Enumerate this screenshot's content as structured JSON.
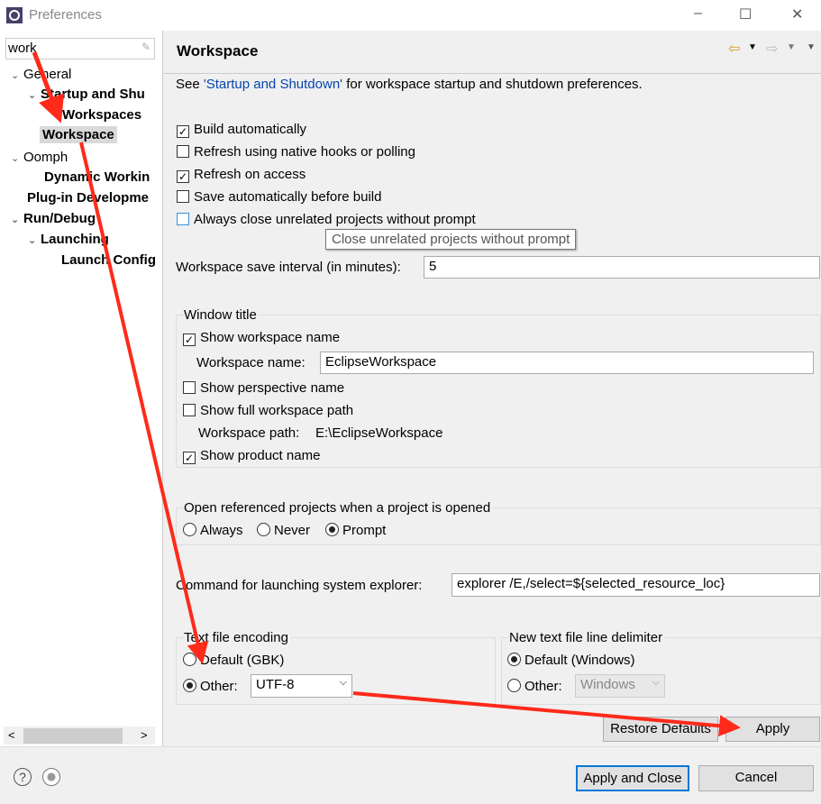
{
  "window": {
    "title": "Preferences",
    "minimize": "–",
    "maximize": "☐",
    "close": "✕"
  },
  "filter": {
    "value": "work"
  },
  "tree": [
    {
      "label": "General",
      "bold": false
    },
    {
      "label": "Startup and Shu",
      "bold": true
    },
    {
      "label": "Workspaces",
      "bold": true
    },
    {
      "label": "Workspace",
      "bold": true,
      "selected": true
    },
    {
      "label": "Oomph",
      "bold": false
    },
    {
      "label": "Dynamic Workin",
      "bold": true
    },
    {
      "label": "Plug-in Developme",
      "bold": true
    },
    {
      "label": "Run/Debug",
      "bold": true
    },
    {
      "label": "Launching",
      "bold": true
    },
    {
      "label": "Launch Config",
      "bold": true
    }
  ],
  "page": {
    "title": "Workspace",
    "see_prefix": "See ",
    "see_link": "'Startup and Shutdown'",
    "see_suffix": " for workspace startup and shutdown preferences.",
    "options": [
      {
        "label": "Build automatically",
        "checked": true
      },
      {
        "label": "Refresh using native hooks or polling",
        "checked": false
      },
      {
        "label": "Refresh on access",
        "checked": true
      },
      {
        "label": "Save automatically before build",
        "checked": false
      },
      {
        "label": "Always close unrelated projects without prompt",
        "checked": false
      }
    ],
    "tooltip": "Close unrelated projects without prompt",
    "save_interval_label": "Workspace save interval (in minutes):",
    "save_interval_value": "5",
    "window_title": {
      "heading": "Window title",
      "show_ws_name": {
        "label": "Show workspace name",
        "checked": true
      },
      "ws_name_label": "Workspace name:",
      "ws_name_value": "EclipseWorkspace",
      "show_perspective": {
        "label": "Show perspective name",
        "checked": false
      },
      "show_full_path": {
        "label": "Show full workspace path",
        "checked": false
      },
      "ws_path_label": "Workspace path:",
      "ws_path_value": "E:\\EclipseWorkspace",
      "show_product": {
        "label": "Show product name",
        "checked": true
      }
    },
    "open_ref": {
      "heading": "Open referenced projects when a project is opened",
      "options": [
        "Always",
        "Never",
        "Prompt"
      ],
      "selected": "Prompt"
    },
    "explorer_label": "Command for launching system explorer:",
    "explorer_value": "explorer /E,/select=${selected_resource_loc}",
    "encoding": {
      "heading": "Text file encoding",
      "default_label": "Default (GBK)",
      "other_label": "Other:",
      "other_value": "UTF-8",
      "selected": "Other"
    },
    "delimiter": {
      "heading": "New text file line delimiter",
      "default_label": "Default (Windows)",
      "other_label": "Other:",
      "other_value": "Windows",
      "selected": "Default"
    },
    "restore_defaults": "Restore Defaults",
    "apply": "Apply"
  },
  "footer": {
    "help": "?",
    "apply_close": "Apply and Close",
    "cancel": "Cancel"
  },
  "annotation_color": "#ff2a1a"
}
